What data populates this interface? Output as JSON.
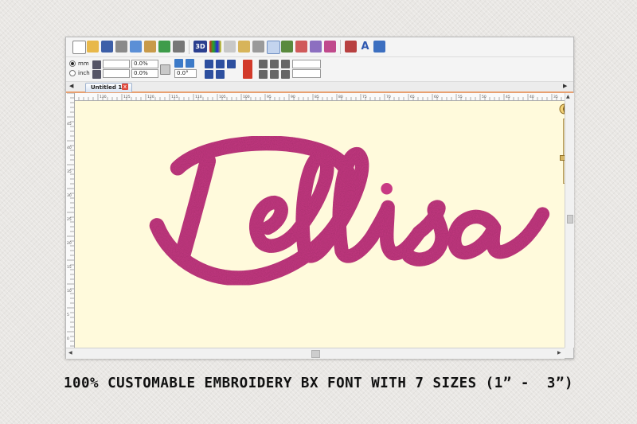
{
  "toolbar": {
    "view_3d_label": "3D",
    "text_tool_label": "A"
  },
  "units": {
    "mm_label": "mm",
    "inch_label": "inch",
    "selected": "mm"
  },
  "transform": {
    "width_value": "",
    "width_percent": "0.0%",
    "height_value": "",
    "height_percent": "0.0%",
    "rotation_value": "",
    "rotation_angle": "0.0°"
  },
  "tab": {
    "title": "Untitled 1 *",
    "close_glyph": "x"
  },
  "ruler_top_labels": [
    "130",
    "125",
    "120",
    "115",
    "110",
    "105",
    "100",
    "95",
    "90",
    "85",
    "80",
    "75",
    "70",
    "65",
    "60",
    "55",
    "50",
    "45",
    "40",
    "35"
  ],
  "ruler_left_labels": [
    "45",
    "40",
    "35",
    "30",
    "25",
    "20",
    "15",
    "10",
    "5",
    "0"
  ],
  "compass_label": "N",
  "design": {
    "text": "Dellisa",
    "thread_color": "#c83a84"
  },
  "caption": "100% CUSTOMABLE EMBROIDERY BX FONT WITH 7 SIZES (1” -  3”)"
}
